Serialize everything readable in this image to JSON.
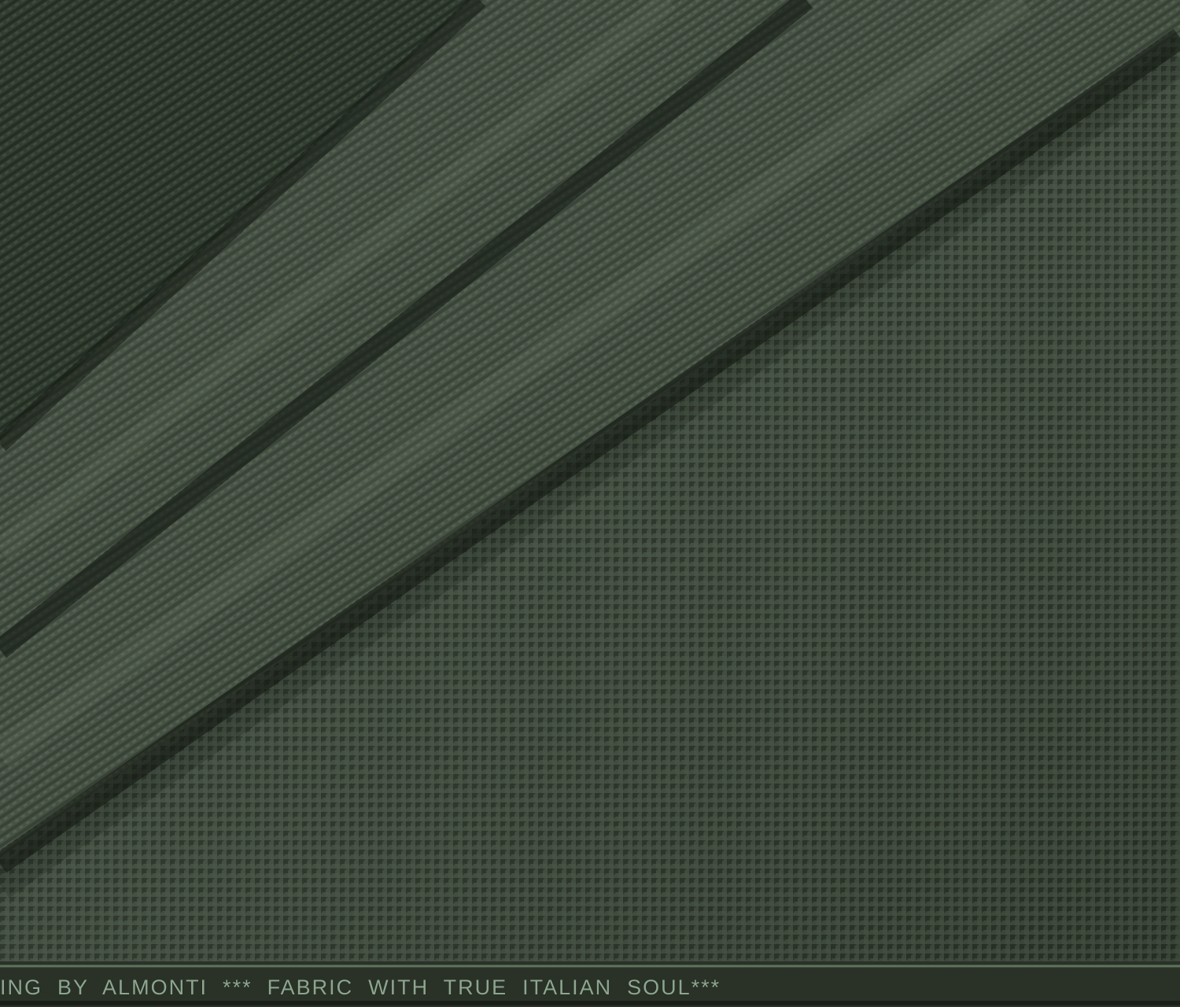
{
  "photo": {
    "subject": "folded olive green fabric with fine houndstooth weave",
    "colors": {
      "base": "#3d4a3b",
      "dark": "#1f271e",
      "highlight": "#5d6e5a",
      "selvedge_band": "#2a3228",
      "selvedge_line": "#6f8a6f",
      "text": "#8da68f"
    }
  },
  "selvedge": {
    "text": "ING  BY  ALMONTI  ***  FABRIC  WITH  TRUE  ITALIAN  SOUL***"
  }
}
